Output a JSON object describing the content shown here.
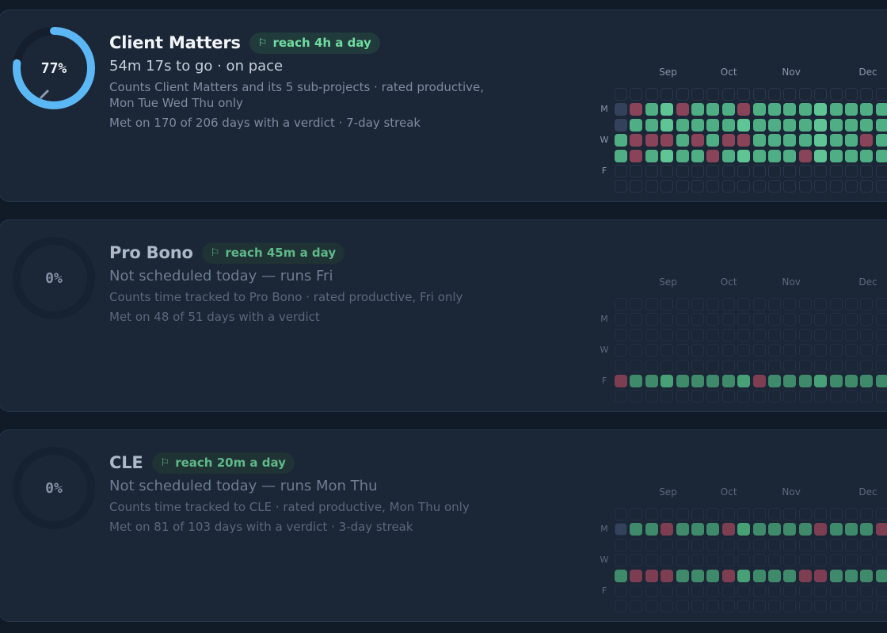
{
  "colors": {
    "accent": "#5bb8f5",
    "ok": "#4fae83",
    "bad": "#8a4459",
    "badge_text": "#6fdca0"
  },
  "goals": [
    {
      "name": "Client Matters",
      "badge": "reach 4h a day",
      "flag_icon": "⚐",
      "progress_text": "77%",
      "progress": 0.77,
      "status": "54m 17s to go · on pace",
      "description_line1": "Counts Client Matters and its 5 sub-projects · rated productive,",
      "description_line2": "Mon Tue Wed Thu only",
      "met": "Met on 170 of 206 days with a verdict · 7-day streak",
      "months": [
        "Sep",
        "Oct",
        "Nov",
        "Dec"
      ],
      "day_labels": [
        "M",
        "W",
        "F"
      ],
      "grid": [
        "--------------------",
        "nbggbgggbggggggggg",
        "nggggggggggggggggggg",
        "gbbbgbgbbgggggggbggg",
        "gbggggbgggggbggggggg",
        "--------------------",
        "--------------------"
      ]
    },
    {
      "name": "Pro Bono",
      "badge": "reach 45m a day",
      "flag_icon": "⚐",
      "progress_text": "0%",
      "progress": 0,
      "status": "Not scheduled today — runs Fri",
      "description_line1": "Counts time tracked to Pro Bono · rated productive, Fri only",
      "description_line2": "",
      "met": "Met on 48 of 51 days with a verdict",
      "months": [
        "Sep",
        "Oct",
        "Nov",
        "Dec"
      ],
      "day_labels": [
        "M",
        "W",
        "F"
      ],
      "grid": [
        "--------------------",
        "--------------------",
        "--------------------",
        "--------------------",
        "--------------------",
        "bggggggggbgggggggggg",
        "--------------------"
      ]
    },
    {
      "name": "CLE",
      "badge": "reach 20m a day",
      "flag_icon": "⚐",
      "progress_text": "0%",
      "progress": 0,
      "status": "Not scheduled today — runs Mon Thu",
      "description_line1": "Counts time tracked to CLE · rated productive, Mon Thu only",
      "description_line2": "",
      "met": "Met on 81 of 103 days with a verdict · 3-day streak",
      "months": [
        "Sep",
        "Oct",
        "Nov",
        "Dec"
      ],
      "day_labels": [
        "M",
        "W",
        "F"
      ],
      "grid": [
        "--------------------",
        "nggbgggbgggggbgggb",
        "--------------------",
        "--------------------",
        "gbbbgggbggggbbgggg",
        "--------------------",
        "--------------------"
      ]
    }
  ]
}
